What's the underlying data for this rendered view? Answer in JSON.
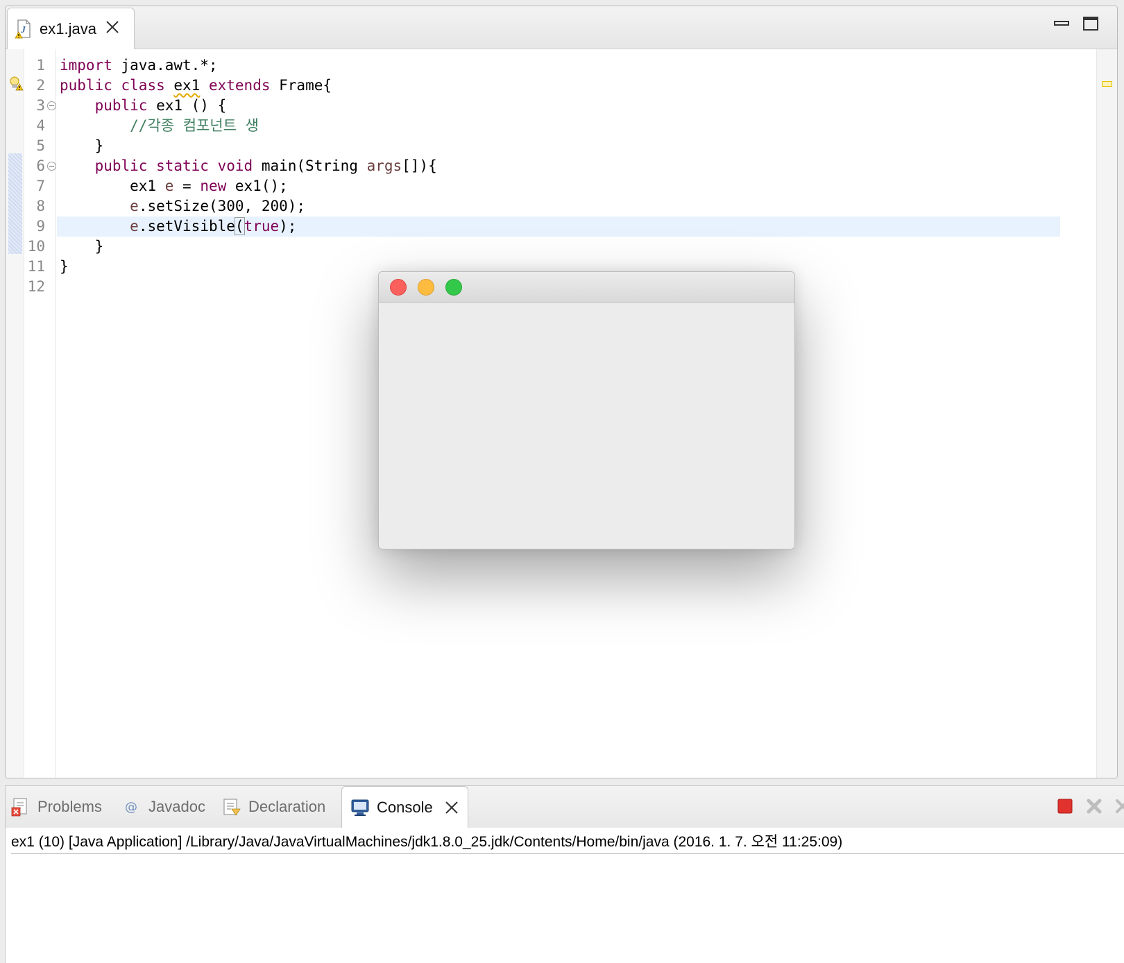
{
  "editor": {
    "tab": {
      "label": "ex1.java",
      "icon": "java-file-warning-icon",
      "close_icon": "close-icon"
    },
    "window_controls": {
      "minimize_icon": "minimize-icon",
      "maximize_icon": "maximize-icon"
    },
    "current_line": 9,
    "warning_line": 2,
    "line_numbers": [
      "1",
      "2",
      "3",
      "4",
      "5",
      "6",
      "7",
      "8",
      "9",
      "10",
      "11",
      "12"
    ],
    "folding_lines": [
      3,
      6
    ],
    "lines": [
      [
        {
          "t": "import",
          "c": "kw"
        },
        {
          "t": " java.awt.*;",
          "c": ""
        }
      ],
      [
        {
          "t": "public",
          "c": "kw"
        },
        {
          "t": " ",
          "c": ""
        },
        {
          "t": "class",
          "c": "kw"
        },
        {
          "t": " ",
          "c": ""
        },
        {
          "t": "ex1",
          "c": "warn"
        },
        {
          "t": " ",
          "c": ""
        },
        {
          "t": "extends",
          "c": "kw"
        },
        {
          "t": " Frame{",
          "c": ""
        }
      ],
      [
        {
          "t": "    ",
          "c": ""
        },
        {
          "t": "public",
          "c": "kw"
        },
        {
          "t": " ex1 () {",
          "c": ""
        }
      ],
      [
        {
          "t": "        ",
          "c": ""
        },
        {
          "t": "//각종 컴포넌트 생",
          "c": "cmt"
        }
      ],
      [
        {
          "t": "    }",
          "c": ""
        }
      ],
      [
        {
          "t": "    ",
          "c": ""
        },
        {
          "t": "public",
          "c": "kw"
        },
        {
          "t": " ",
          "c": ""
        },
        {
          "t": "static",
          "c": "kw"
        },
        {
          "t": " ",
          "c": ""
        },
        {
          "t": "void",
          "c": "kw"
        },
        {
          "t": " main(String ",
          "c": ""
        },
        {
          "t": "args",
          "c": "var"
        },
        {
          "t": "[]){",
          "c": ""
        }
      ],
      [
        {
          "t": "        ex1 ",
          "c": ""
        },
        {
          "t": "e",
          "c": "var"
        },
        {
          "t": " = ",
          "c": ""
        },
        {
          "t": "new",
          "c": "kw"
        },
        {
          "t": " ex1();",
          "c": ""
        }
      ],
      [
        {
          "t": "        ",
          "c": ""
        },
        {
          "t": "e",
          "c": "var"
        },
        {
          "t": ".setSize(300, 200);",
          "c": ""
        }
      ],
      [
        {
          "t": "        ",
          "c": ""
        },
        {
          "t": "e",
          "c": "var"
        },
        {
          "t": ".setVisible",
          "c": ""
        },
        {
          "t": "(",
          "c": "bracket"
        },
        {
          "t": "true",
          "c": "kw"
        },
        {
          "t": ");",
          "c": ""
        }
      ],
      [
        {
          "t": "    }",
          "c": ""
        }
      ],
      [
        {
          "t": "}",
          "c": ""
        }
      ],
      []
    ]
  },
  "awt_window": {
    "close_icon": "close-traffic-light-icon",
    "minimize_icon": "minimize-traffic-light-icon",
    "zoom_icon": "zoom-traffic-light-icon"
  },
  "bottom_panel": {
    "tabs": [
      {
        "label": "Problems",
        "icon": "problems-icon",
        "active": false
      },
      {
        "label": "Javadoc",
        "icon": "javadoc-icon",
        "active": false
      },
      {
        "label": "Declaration",
        "icon": "declaration-icon",
        "active": false
      },
      {
        "label": "Console",
        "icon": "console-icon",
        "active": true
      }
    ],
    "console_close_icon": "close-icon",
    "toolbar": {
      "terminate_icon": "terminate-icon",
      "remove_launch_icon": "remove-launch-icon",
      "remove_all_icon": "remove-all-launches-icon"
    },
    "console_header": "ex1 (10) [Java Application] /Library/Java/JavaVirtualMachines/jdk1.8.0_25.jdk/Contents/Home/bin/java (2016. 1. 7. 오전 11:25:09)"
  },
  "colors": {
    "keyword": "#7f0055",
    "comment": "#3f7f5f",
    "local_variable": "#6a3e3e",
    "current_line": "#e8f2fe",
    "terminate_red": "#e1322e"
  }
}
